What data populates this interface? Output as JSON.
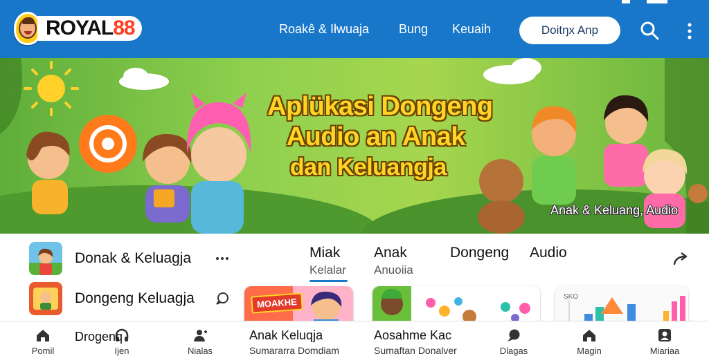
{
  "header": {
    "logo": {
      "text_a": "ROYAL",
      "text_b": "88"
    },
    "nav": [
      "Roakê & Iłwuaja",
      "Bung",
      "Keuaih"
    ],
    "cta": "Doitŋx Anp",
    "icons": [
      "search-icon",
      "more-vert-icon"
    ],
    "bg": "#1877c9"
  },
  "hero": {
    "title_lines": [
      "Aplükasi Dongeng",
      "Audio an Anak",
      "dan Keluangja"
    ],
    "caption": "Anak & Keluang, Audio",
    "title_color": "#ffd427"
  },
  "sidebar": {
    "items": [
      {
        "label": "Donak & Keluagja",
        "action_icon": "more-horiz-icon"
      },
      {
        "label": "Dongeng Keluagja",
        "action_icon": "chat-icon"
      }
    ]
  },
  "tabs": [
    {
      "label": "Miak",
      "sub": "Kelalar",
      "active": true
    },
    {
      "label": "Anak",
      "sub": "Anuoiia",
      "active": false
    },
    {
      "label": "Dongeng",
      "sub": "",
      "active": false
    },
    {
      "label": "Audio",
      "sub": "",
      "active": false
    }
  ],
  "cards": [
    {
      "badge": "MOAKHE",
      "image": "cartoon-kid-thumbnail"
    },
    {
      "image": "kids-and-toys-thumbnail"
    },
    {
      "image": "chart-thumbnail",
      "mini_label": "SKO"
    }
  ],
  "bottom_nav": {
    "items": [
      {
        "icon": "home-icon",
        "label": "Pomil"
      },
      {
        "icon": "headphones-icon",
        "label": "Ijen"
      },
      {
        "icon": "people-icon",
        "label": "Nialas"
      },
      {
        "icon": "chat-bubble-icon",
        "label": "Dlagas"
      },
      {
        "icon": "home-icon",
        "label": "Magin"
      },
      {
        "icon": "profile-icon",
        "label": "Miariaa"
      }
    ],
    "overlay_label": "Drogenq",
    "center_panel": [
      {
        "title": "Anak Keluqja",
        "sub": "Sumararra Domdiam"
      },
      {
        "title": "Aosahme Kac",
        "sub": "Sumaftan Donalver"
      }
    ]
  }
}
